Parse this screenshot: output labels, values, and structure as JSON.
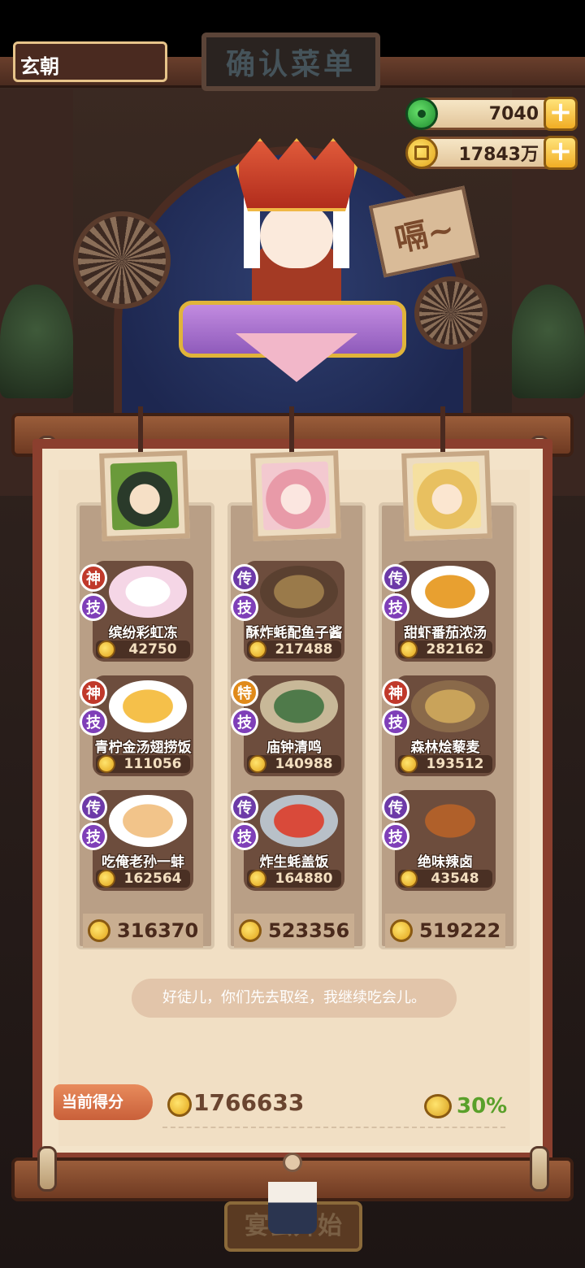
{
  "hud": {
    "player_name": "玄朝",
    "sign_title": "确认菜单",
    "jade_amount": "7040",
    "coin_amount": "17843万",
    "plus": "+"
  },
  "speech_sign": "嗝~",
  "columns": [
    {
      "total": "316370",
      "dishes": [
        {
          "rank": "神",
          "skill": "技",
          "name": "缤纷彩虹冻",
          "score": "42750",
          "color": "#f5d6e6"
        },
        {
          "rank": "神",
          "skill": "技",
          "name": "青柠金汤翅捞饭",
          "score": "111056",
          "color": "#f5c04a"
        },
        {
          "rank": "传",
          "skill": "技",
          "name": "吃俺老孙一蚌",
          "score": "162564",
          "color": "#f2c48a"
        }
      ]
    },
    {
      "total": "523356",
      "dishes": [
        {
          "rank": "传",
          "skill": "技",
          "name": "酥炸蚝配鱼子酱",
          "score": "217488",
          "color": "#9a7a4a"
        },
        {
          "rank": "特",
          "skill": "技",
          "name": "庙钟清鸣",
          "score": "140988",
          "color": "#4f7a4a"
        },
        {
          "rank": "传",
          "skill": "技",
          "name": "炸生蚝盖饭",
          "score": "164880",
          "color": "#d94a3a"
        }
      ]
    },
    {
      "total": "519222",
      "dishes": [
        {
          "rank": "传",
          "skill": "技",
          "name": "甜虾番茄浓汤",
          "score": "282162",
          "color": "#e8a030"
        },
        {
          "rank": "神",
          "skill": "技",
          "name": "森林烩藜麦",
          "score": "193512",
          "color": "#c9a35a"
        },
        {
          "rank": "传",
          "skill": "技",
          "name": "绝味辣卤",
          "score": "43548",
          "color": "#b0602a"
        }
      ]
    }
  ],
  "message": "好徒儿，你们先去取经，我继续吃会儿。",
  "score": {
    "label": "当前得分",
    "value": "1766633",
    "bonus": "30%"
  },
  "start_button": "宴会开始",
  "colors": {
    "frame": "#8b3f2e",
    "paper": "#f3e3c9",
    "card": "#6d4d3d",
    "bonus_green": "#5aa02a"
  }
}
